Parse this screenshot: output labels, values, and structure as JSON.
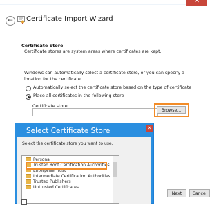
{
  "window": {
    "title": "Certificate Import Wizard",
    "accent": "#2b8fe0",
    "highlight": "#f28c28"
  },
  "store_section": {
    "title": "Certificate Store",
    "description": "Certificate stores are system areas where certificates are kept."
  },
  "intro": "Windows can automatically select a certificate store, or you can specify a location for the certificate.",
  "options": {
    "auto_label": "Automatically select the certificate store based on the type of certificate",
    "place_label": "Place all certificates in the following store",
    "selected": "place"
  },
  "store_field": {
    "label": "Certificate store:",
    "value": "",
    "browse_label": "Browse..."
  },
  "dialog": {
    "title": "Select Certificate Store",
    "prompt": "Select the certificate store you want to use.",
    "stores": [
      "Personal",
      "Trusted Root Certification Authorities",
      "Enterprise Trust",
      "Intermediate Certification Authorities",
      "Trusted Publishers",
      "Untrusted Certificates"
    ],
    "selected_store": "Trusted Root Certification Authorities"
  },
  "footer": {
    "next_label": "Next",
    "cancel_label": "Cancel"
  }
}
